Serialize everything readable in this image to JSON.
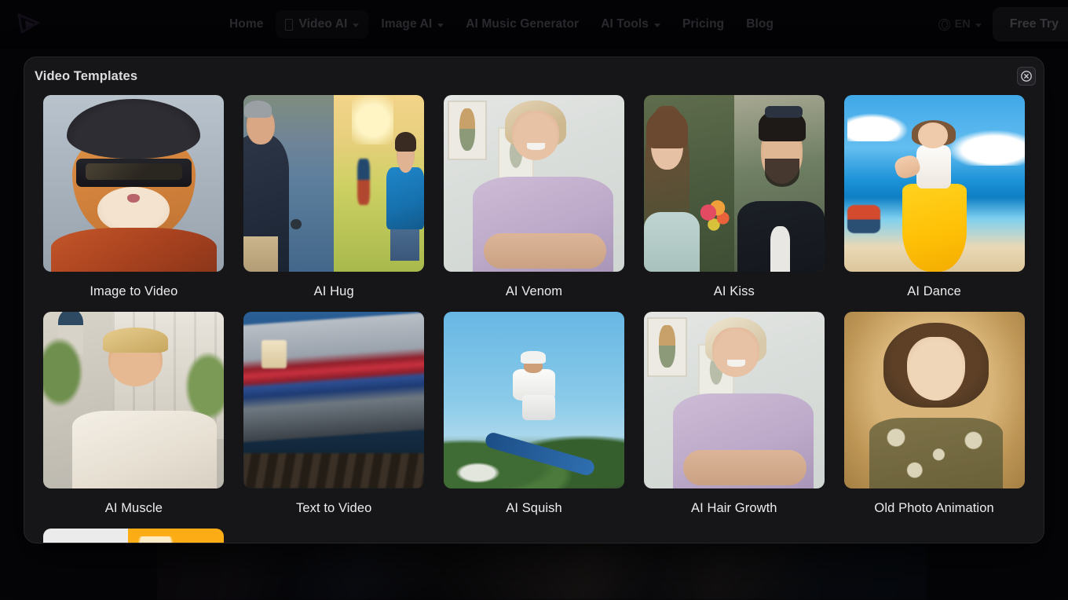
{
  "navbar": {
    "logo_name": "play-logo",
    "links": [
      {
        "label": "Home",
        "has_caret": false,
        "active": false,
        "has_icon": false
      },
      {
        "label": "Video AI",
        "has_caret": true,
        "active": true,
        "has_icon": true
      },
      {
        "label": "Image AI",
        "has_caret": true,
        "active": false,
        "has_icon": false
      },
      {
        "label": "AI Music Generator",
        "has_caret": false,
        "active": false,
        "has_icon": false
      },
      {
        "label": "AI Tools",
        "has_caret": true,
        "active": false,
        "has_icon": false
      },
      {
        "label": "Pricing",
        "has_caret": false,
        "active": false,
        "has_icon": false
      },
      {
        "label": "Blog",
        "has_caret": false,
        "active": false,
        "has_icon": false
      }
    ],
    "language": "EN",
    "cta_label": "Free Try"
  },
  "modal": {
    "title": "Video Templates",
    "close_label": "✕",
    "templates": [
      {
        "label": "Image to Video",
        "art": "cat"
      },
      {
        "label": "AI Hug",
        "art": "hug"
      },
      {
        "label": "AI Venom",
        "art": "venom"
      },
      {
        "label": "AI Kiss",
        "art": "kiss"
      },
      {
        "label": "AI Dance",
        "art": "dance"
      },
      {
        "label": "AI Muscle",
        "art": "muscle"
      },
      {
        "label": "Text to Video",
        "art": "train"
      },
      {
        "label": "AI Squish",
        "art": "skate"
      },
      {
        "label": "AI Hair Growth",
        "art": "hair"
      },
      {
        "label": "Old Photo Animation",
        "art": "oldphoto"
      }
    ]
  },
  "colors": {
    "page_bg": "#0a0a0c",
    "modal_bg": "#161618",
    "modal_border": "#252528",
    "label_text": "#ececed",
    "title_text": "#dcdce0",
    "nav_text": "#8d8d96",
    "cta_bg": "#2a2a2e"
  }
}
